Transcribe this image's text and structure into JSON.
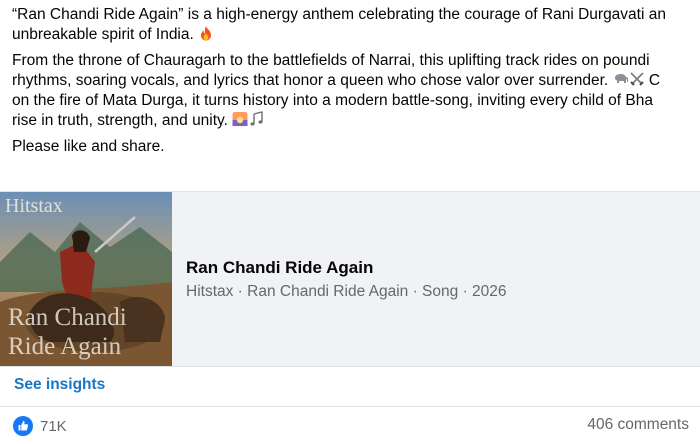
{
  "post": {
    "para1_line1": "“Ran Chandi Ride Again” is a high-energy anthem celebrating the courage of Rani Durgavati an",
    "para1_line2": "unbreakable spirit of India.",
    "para2_line1": "From the throne of Chauragarh to the battlefields of Narrai, this uplifting track rides on poundi",
    "para2_line2": "rhythms, soaring vocals, and lyrics that honor a queen who chose valor over surrender.",
    "para2_line2_tail": "C",
    "para2_line3": "on the fire of Mata Durga, it turns history into a modern battle-song, inviting every child of Bha",
    "para2_line4": "rise in truth, strength, and unity.",
    "para3": "Please like and share."
  },
  "card": {
    "thumb_text_top": "Hitstax",
    "thumb_text_mid": "Ran Chandi",
    "thumb_text_bot": "Ride Again",
    "title": "Ran Chandi Ride Again",
    "subtitle": "Hitstax · Ran Chandi Ride Again · Song · 2026"
  },
  "insights_label": "See insights",
  "footer": {
    "like_count": "71K",
    "comments": "406 comments"
  },
  "colors": {
    "link": "#1877c5",
    "card_bg": "#f0f2f5",
    "muted": "#65676b",
    "like": "#1877f2"
  },
  "icons": [
    "fire-emoji-icon",
    "elephant-emoji-icon",
    "crossed-swords-emoji-icon",
    "sunrise-emoji-icon",
    "music-notes-emoji-icon",
    "like-thumb-icon"
  ]
}
